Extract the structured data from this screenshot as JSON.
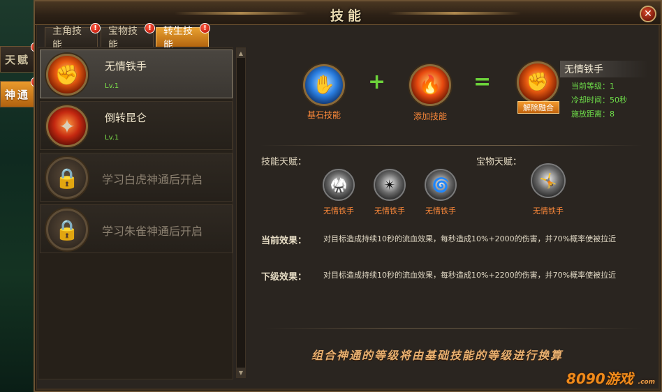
{
  "window": {
    "title": "技能"
  },
  "side_tabs": [
    {
      "label": "天赋",
      "active": false,
      "alert": "!"
    },
    {
      "label": "神通",
      "active": true,
      "alert": "!"
    }
  ],
  "top_tabs": [
    {
      "label": "主角技能",
      "active": false,
      "alert": "!"
    },
    {
      "label": "宝物技能",
      "active": false,
      "alert": "!"
    },
    {
      "label": "转生技能",
      "active": true,
      "alert": "!"
    }
  ],
  "skill_list": [
    {
      "name": "无情铁手",
      "level": "Lv.1",
      "icon": "flaming-fist-icon",
      "locked": false,
      "selected": true
    },
    {
      "name": "倒转昆仑",
      "level": "Lv.1",
      "icon": "red-burst-icon",
      "locked": false,
      "selected": false
    },
    {
      "name": "学习白虎神通后开启",
      "icon": "lock-icon",
      "locked": true
    },
    {
      "name": "学习朱雀神通后开启",
      "icon": "lock-icon",
      "locked": true
    }
  ],
  "combo": {
    "base_label": "基石技能",
    "add_label": "添加技能",
    "plus": "+",
    "equals": "=",
    "unfuse_label": "解除融合",
    "result": {
      "name": "无情铁手",
      "level_line": "当前等级：1",
      "cooldown_line": "冷却时间：50秒",
      "range_line": "施放距离：8"
    }
  },
  "talents": {
    "skill_label": "技能天赋：",
    "treasure_label": "宝物天赋：",
    "skill_talents": [
      "无情铁手",
      "无情铁手",
      "无情铁手"
    ],
    "treasure_talents": [
      "无情铁手"
    ]
  },
  "effects": {
    "current_label": "当前效果：",
    "current_text": "对目标造成持续10秒的流血效果，每秒造成10%+2000的伤害，并70%概率使被拉近",
    "next_label": "下级效果：",
    "next_text": "对目标造成持续10秒的流血效果，每秒造成10%+2200的伤害，并70%概率使被拉近"
  },
  "footer_note": "组合神通的等级将由基础技能的等级进行换算",
  "watermark": {
    "main": "8090游戏",
    "sub": ".com"
  }
}
